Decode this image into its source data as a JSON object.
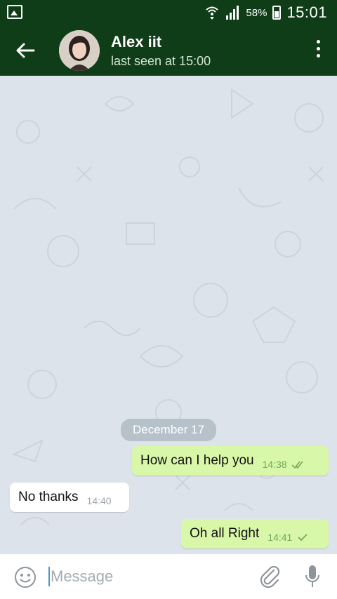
{
  "status_bar": {
    "battery_percent": "58%",
    "time": "15:01",
    "icons": [
      "gallery-notification-icon",
      "wifi-icon",
      "signal-icon",
      "battery-icon"
    ]
  },
  "header": {
    "contact_name": "Alex iit",
    "last_seen": "last seen at 15:00",
    "icons": [
      "back-arrow-icon",
      "more-vert-icon"
    ]
  },
  "chat": {
    "date_divider": "December 17",
    "messages": [
      {
        "direction": "outgoing",
        "text": "How can I help you",
        "time": "14:38",
        "status": "read"
      },
      {
        "direction": "incoming",
        "text": "No thanks",
        "time": "14:40"
      },
      {
        "direction": "outgoing",
        "text": "Oh all Right",
        "time": "14:41",
        "status": "delivered"
      }
    ]
  },
  "composer": {
    "placeholder": "Message",
    "icons": [
      "emoji-icon",
      "attach-icon",
      "mic-icon"
    ]
  },
  "colors": {
    "header_bg": "#0f3d17",
    "chat_bg": "#dde3ea",
    "outgoing_bubble": "#d9f7a9",
    "incoming_bubble": "#ffffff",
    "check_green": "#72a85b"
  }
}
